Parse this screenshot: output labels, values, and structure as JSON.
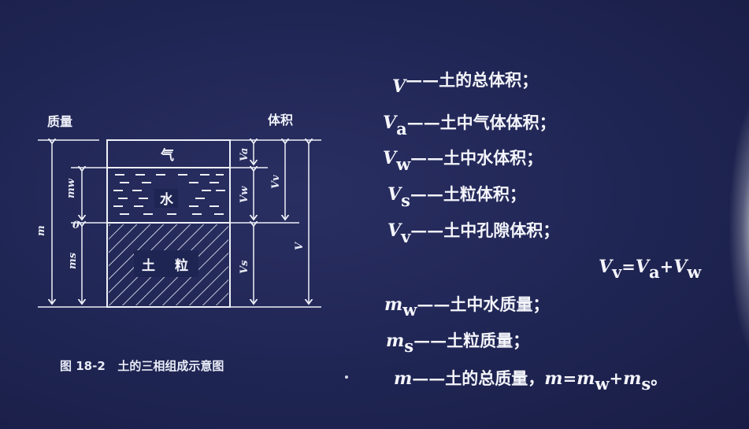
{
  "figure": {
    "mass_header": "质量",
    "volume_header": "体积",
    "caption": "图 18-2   土的三相组成示意图",
    "phase_air": "气",
    "phase_water": "水",
    "phase_soil_1": "土",
    "phase_soil_2": "粒",
    "mass_symbols": {
      "total": "m",
      "water": "mw",
      "solid": "ms",
      "air": "0"
    },
    "volume_symbols": {
      "air": "Va",
      "water": "Vw",
      "solid": "Vs",
      "void": "Vv",
      "total": "V"
    }
  },
  "definitions": [
    {
      "sym": "V",
      "sub": "",
      "text": "土的总体积；"
    },
    {
      "sym": "V",
      "sub": "a",
      "text": "土中气体体积；"
    },
    {
      "sym": "V",
      "sub": "w",
      "text": "土中水体积；"
    },
    {
      "sym": "V",
      "sub": "s",
      "text": "土粒体积；"
    },
    {
      "sym": "V",
      "sub": "v",
      "text": "土中孔隙体积；"
    }
  ],
  "equation1": {
    "lhs": "V",
    "lhs_sub": "v",
    "eq": "=",
    "a": "V",
    "a_sub": "a",
    "plus": "+",
    "b": "V",
    "b_sub": "w"
  },
  "mass_definitions": [
    {
      "sym": "m",
      "sub": "w",
      "text": "土中水质量；"
    },
    {
      "sym": "m",
      "sub": "s",
      "text": "土粒质量；"
    },
    {
      "sym": "m",
      "sub": "",
      "text": "土的总质量，"
    }
  ],
  "equation2": {
    "lhs": "m",
    "eq": "=",
    "a": "m",
    "a_sub": "w",
    "plus": "+",
    "b": "m",
    "b_sub": "s",
    "end": "。"
  },
  "dash": "——",
  "colors": {
    "background": "#1f2553",
    "ink": "#f4f5fb"
  }
}
